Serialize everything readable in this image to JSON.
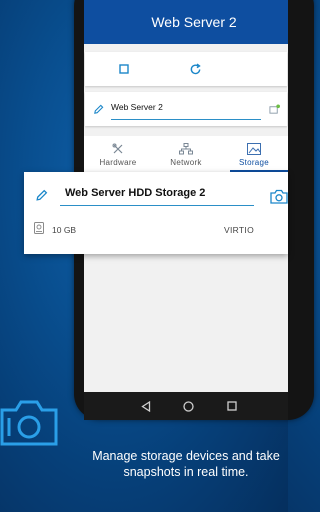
{
  "app": {
    "title": "Web Server 2"
  },
  "name_card": {
    "server_name": "Web Server 2"
  },
  "tabs": [
    {
      "label": "Hardware",
      "icon": "wrench-screwdriver-icon",
      "active": false
    },
    {
      "label": "Network",
      "icon": "network-icon",
      "active": false
    },
    {
      "label": "Storage",
      "icon": "storage-image-icon",
      "active": true
    }
  ],
  "storage": {
    "name": "Web Server HDD Storage 2",
    "size": "10 GB",
    "bus": "VIRTIO"
  },
  "caption": "Manage storage devices and take snapshots in real time.",
  "colors": {
    "accent": "#0e4ea0",
    "underline": "#2b8fc7",
    "icon": "#1c87c9",
    "background": "#063f78"
  }
}
